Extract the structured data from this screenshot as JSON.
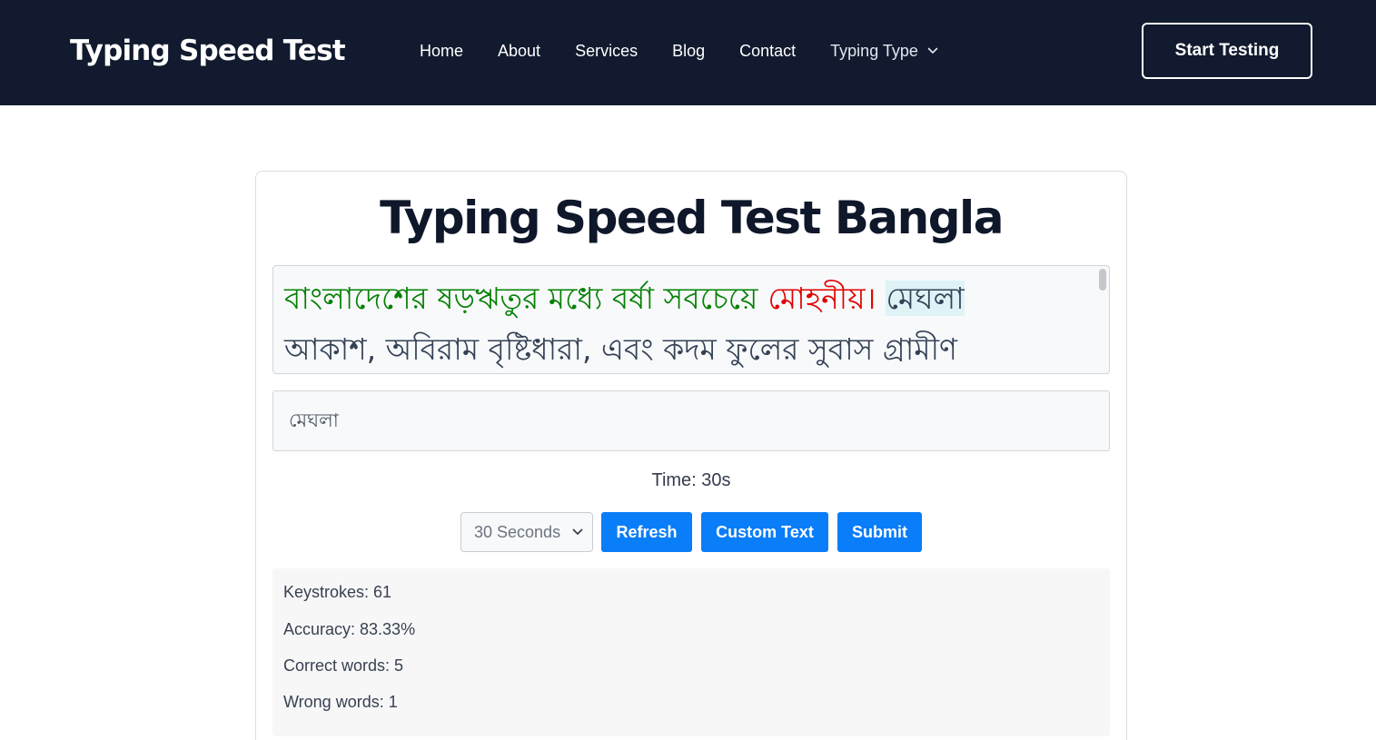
{
  "header": {
    "logo": "Typing Speed Test",
    "nav": [
      {
        "label": "Home"
      },
      {
        "label": "About"
      },
      {
        "label": "Services"
      },
      {
        "label": "Blog"
      },
      {
        "label": "Contact"
      }
    ],
    "dropdown_label": "Typing Type",
    "cta_label": "Start Testing"
  },
  "main": {
    "title": "Typing Speed Test Bangla",
    "passage": {
      "correct": "বাংলাদেশের ষড়ঋতুর মধ্যে বর্ষা সবচেয়ে",
      "wrong": "মোহনীয়।",
      "current": "মেঘলা",
      "pending": "আকাশ, অবিরাম বৃষ্টিধারা, এবং কদম ফুলের সুবাস গ্রামীণ"
    },
    "input_value": "মেঘলা",
    "timer": "Time: 30s",
    "duration_selected": "30 Seconds",
    "buttons": {
      "refresh": "Refresh",
      "custom": "Custom Text",
      "submit": "Submit"
    },
    "stats": {
      "keystrokes": "Keystrokes: 61",
      "accuracy": "Accuracy: 83.33%",
      "correct_words": "Correct words: 5",
      "wrong_words": "Wrong words: 1"
    }
  },
  "colors": {
    "header_bg": "#111a2e",
    "correct": "#028002",
    "wrong": "#e00000",
    "current_highlight": "#dff3f7",
    "button": "#0a7df8"
  },
  "icons": {
    "dropdown": "chevron-down-icon",
    "select": "chevron-down-icon"
  }
}
